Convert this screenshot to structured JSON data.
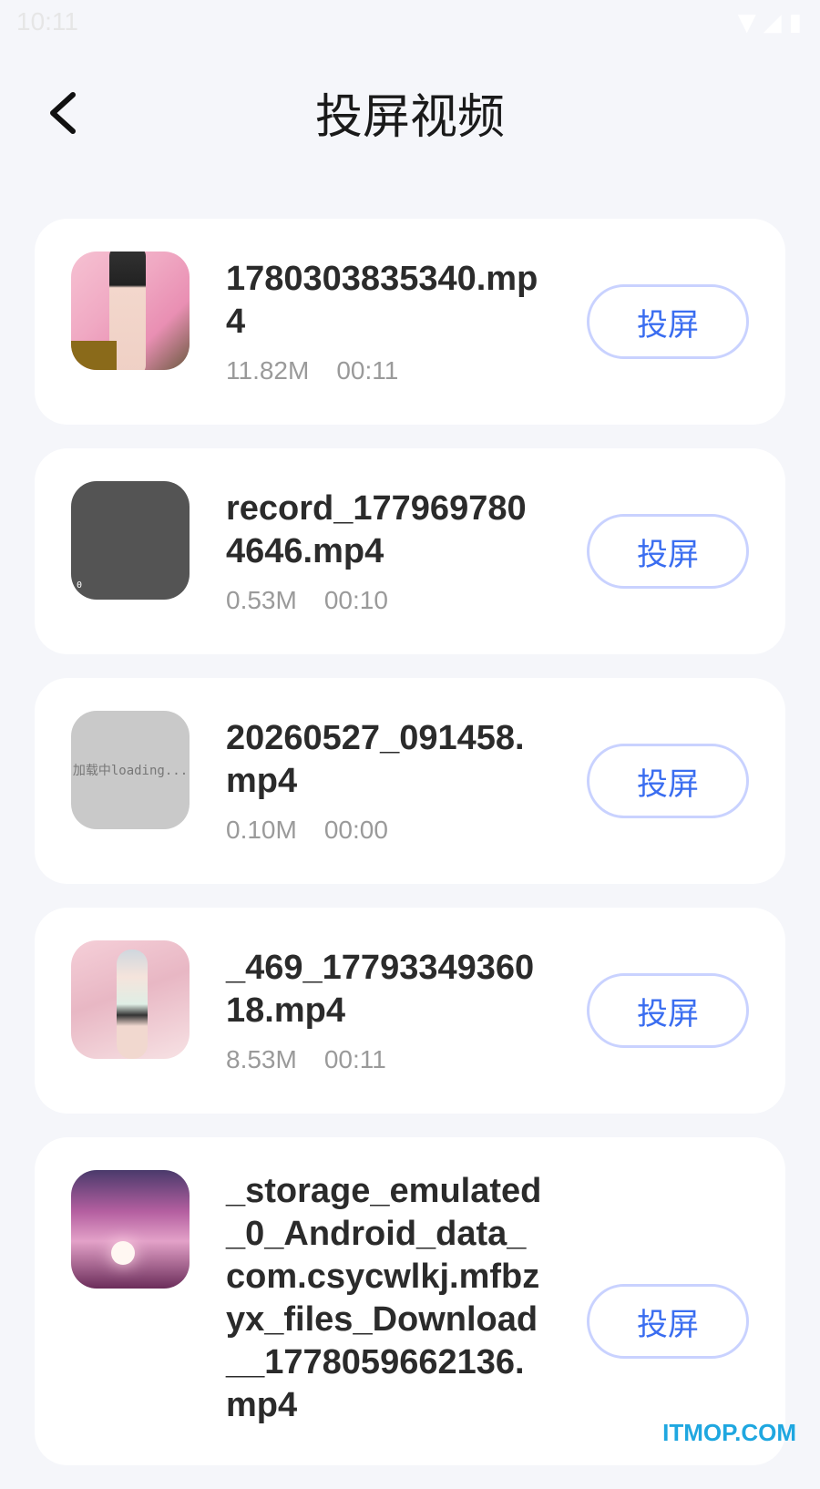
{
  "status": {
    "time": "10:11",
    "icons": [
      "wifi-icon",
      "signal-icon",
      "battery-icon"
    ]
  },
  "header": {
    "title": "投屏视频",
    "back_icon": "chevron-left-icon"
  },
  "videos": [
    {
      "name": "1780303835340.mp4",
      "size": "11.82M",
      "duration": "00:11",
      "button": "投屏",
      "thumb_text": ""
    },
    {
      "name": "record_1779697804646.mp4",
      "size": "0.53M",
      "duration": "00:10",
      "button": "投屏",
      "thumb_text": "0"
    },
    {
      "name": "20260527_091458.mp4",
      "size": "0.10M",
      "duration": "00:00",
      "button": "投屏",
      "thumb_text": "加载中loading..."
    },
    {
      "name": "_469_1779334936018.mp4",
      "size": "8.53M",
      "duration": "00:11",
      "button": "投屏",
      "thumb_text": ""
    },
    {
      "name": "_storage_emulated_0_Android_data_com.csycwlkj.mfbzyx_files_Download__1778059662136.mp4",
      "size": "",
      "duration": "",
      "button": "投屏",
      "thumb_text": ""
    }
  ],
  "watermark": "ITMOP.COM",
  "colors": {
    "accent": "#3a6df0",
    "button_border": "#c9d2ff",
    "background": "#f5f6fa"
  }
}
